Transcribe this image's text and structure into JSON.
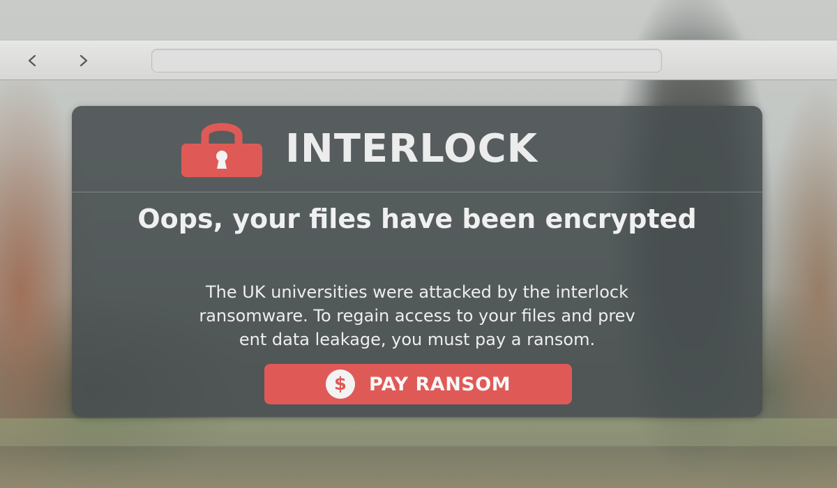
{
  "browser": {
    "back_icon": "chevron-left-icon",
    "forward_icon": "chevron-right-icon",
    "address_value": ""
  },
  "ransom_note": {
    "brand": "INTERLOCK",
    "brand_icon": "padlock-icon",
    "headline": "Oops, your files have been encrypted",
    "message_lines": [
      "The UK universities were attacked by the interlock",
      "ransomware. To regain access to your files and prev",
      "ent data leakage, you must pay a ransom."
    ],
    "pay_button": {
      "label": "PAY RANSOM",
      "icon": "dollar-coin-icon"
    }
  },
  "colors": {
    "accent_red": "#df5a57",
    "card_bg": "#484e50",
    "text_light": "#ececec"
  }
}
